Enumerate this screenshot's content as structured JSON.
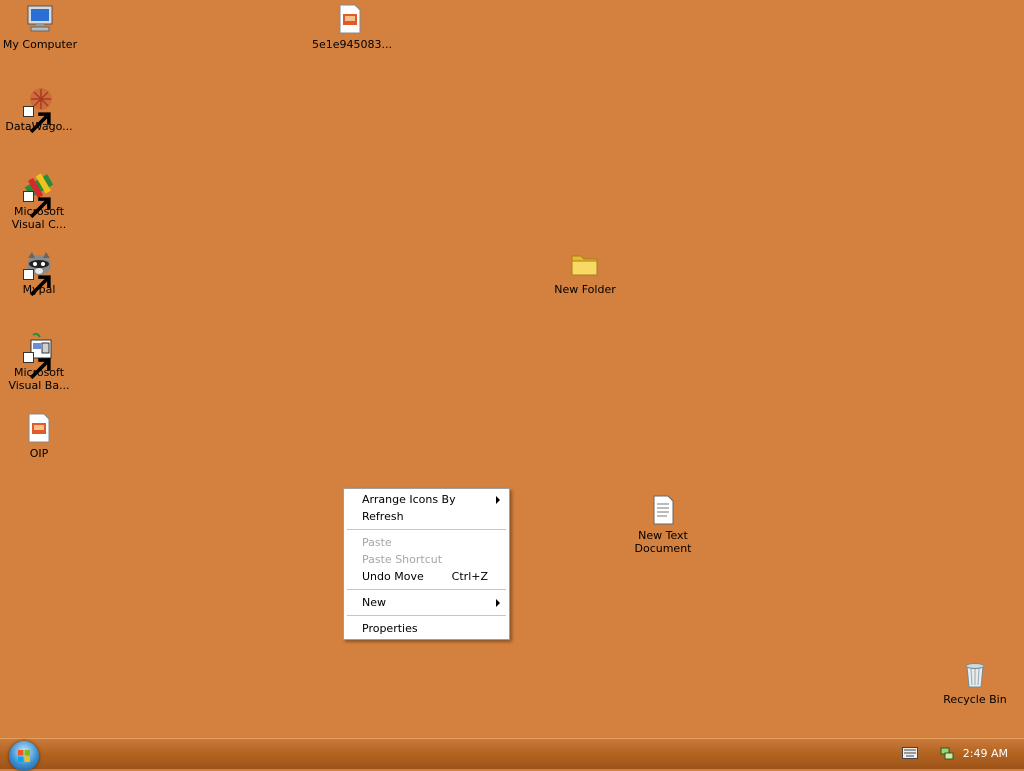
{
  "desktop": {
    "background_color": "#D4813F",
    "icons": [
      {
        "label": "My Computer"
      },
      {
        "label": "5e1e945083..."
      },
      {
        "label": "DataWago..."
      },
      {
        "label": "Microsoft\nVisual C..."
      },
      {
        "label": "Mypal"
      },
      {
        "label": "Microsoft\nVisual Ba..."
      },
      {
        "label": "OIP"
      },
      {
        "label": "New Folder"
      },
      {
        "label": "New Text\nDocument"
      },
      {
        "label": "Recycle Bin"
      }
    ]
  },
  "context_menu": {
    "items": [
      {
        "label": "Arrange Icons By",
        "submenu": true
      },
      {
        "label": "Refresh"
      },
      {
        "label": "Paste",
        "disabled": true
      },
      {
        "label": "Paste Shortcut",
        "disabled": true
      },
      {
        "label": "Undo Move",
        "shortcut": "Ctrl+Z"
      },
      {
        "label": "New",
        "submenu": true
      },
      {
        "label": "Properties"
      }
    ]
  },
  "taskbar": {
    "clock": "2:49 AM",
    "tray_icons": [
      "keyboard-icon",
      "network-icon"
    ],
    "start_icon": "start-orb-icon"
  }
}
